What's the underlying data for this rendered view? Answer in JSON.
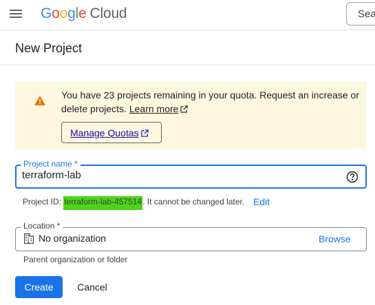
{
  "header": {
    "logo_letters": [
      "G",
      "o",
      "o",
      "g",
      "l",
      "e"
    ],
    "logo_suffix": "Cloud",
    "search_text": "Sea",
    "menu_icon": "hamburger-menu-icon"
  },
  "page": {
    "title": "New Project"
  },
  "banner": {
    "icon": "warning-icon",
    "text": "You have 23 projects remaining in your quota. Request an increase or delete projects.",
    "learn_more": "Learn more",
    "manage_quotas": "Manage Quotas",
    "colors": {
      "background": "#fef7e0",
      "icon": "#e37400"
    }
  },
  "form": {
    "project_name": {
      "label": "Project name *",
      "value": "terraform-lab",
      "help_icon": "help-circle-icon"
    },
    "project_id": {
      "prefix": "Project ID: ",
      "value": "terraform-lab-457514",
      "suffix": ". It cannot be changed later.",
      "edit_label": "Edit",
      "highlight_color": "#4cd41a"
    },
    "location": {
      "label": "Location *",
      "value": "No organization",
      "icon": "building-icon",
      "browse_label": "Browse",
      "helper": "Parent organization or folder"
    }
  },
  "actions": {
    "create": "Create",
    "cancel": "Cancel"
  },
  "colors": {
    "primary": "#1a73e8",
    "focus_border": "#1a73e8",
    "text": "#202124"
  }
}
